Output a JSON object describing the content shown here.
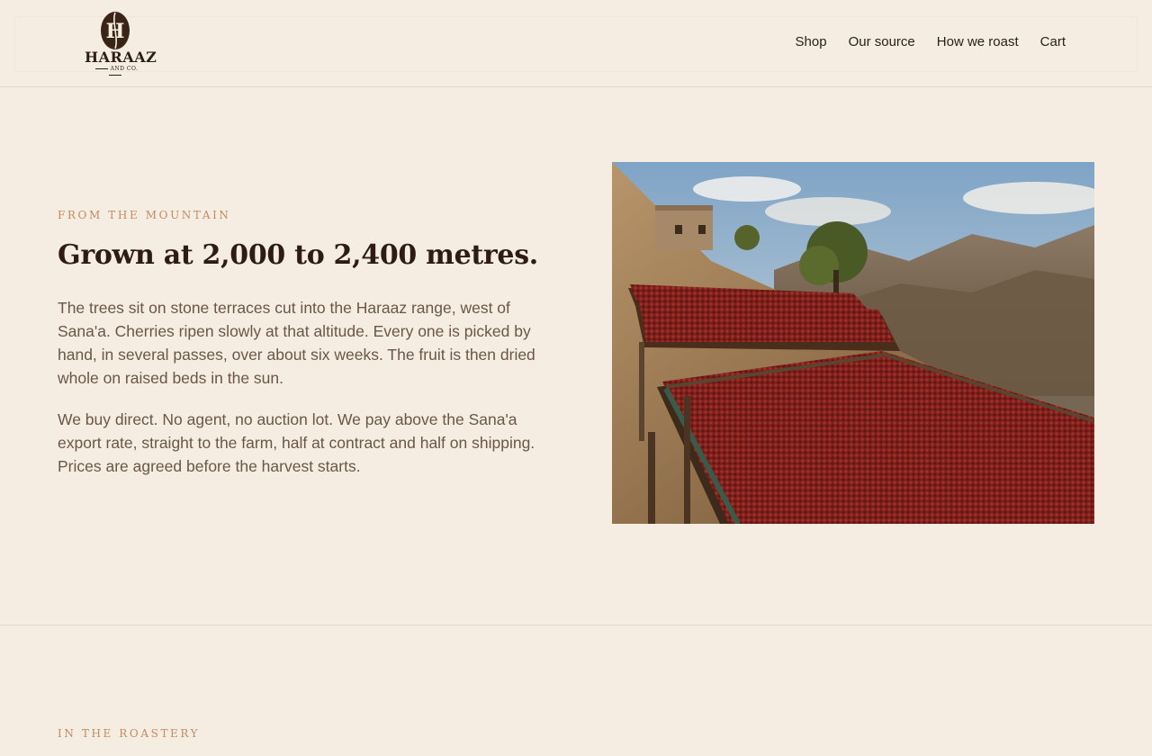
{
  "brand": {
    "logo_monogram": "H",
    "logo_word": "HARAAZ",
    "logo_sub": "AND CO."
  },
  "nav": {
    "items": [
      {
        "label": "Shop"
      },
      {
        "label": "Our source"
      },
      {
        "label": "How we roast"
      },
      {
        "label": "Cart"
      }
    ]
  },
  "source_section": {
    "eyebrow": "FROM THE MOUNTAIN",
    "headline": "Grown at 2,000 to 2,400 metres.",
    "paragraph_1": "The trees sit on stone terraces cut into the Haraaz range, west of Sana'a. Cherries ripen slowly at that altitude. Every one is picked by hand, in several passes, over about six weeks. The fruit is then dried whole on raised beds in the sun.",
    "paragraph_2": "We buy direct. No agent, no auction lot. We pay above the Sana'a export rate, straight to the farm, half at contract and half on shipping. Prices are agreed before the harvest starts.",
    "image_subject": "coffee cherries drying on raised beds on mountain terraces"
  },
  "roastery_section": {
    "eyebrow": "IN THE ROASTERY"
  },
  "colors": {
    "background": "#f5ede1",
    "accent": "#c48a62",
    "text_dark": "#2e1c12",
    "text_body": "#6b5648",
    "divider": "#e1d6c7"
  }
}
